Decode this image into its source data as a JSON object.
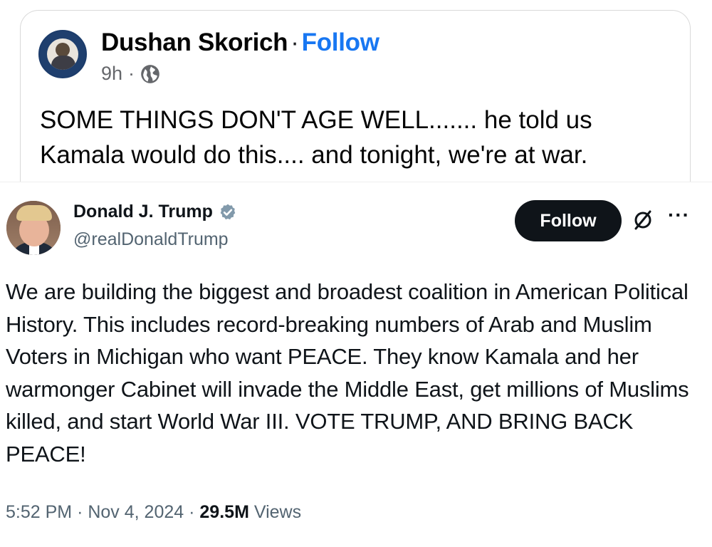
{
  "facebook_post": {
    "author": "Dushan Skorich",
    "separator": "·",
    "follow_label": "Follow",
    "time": "9h",
    "meta_separator": "·",
    "audience_icon": "globe-icon",
    "text": "SOME THINGS DON'T AGE WELL....... he told us Kamala would do this.... and tonight, we're at war."
  },
  "tweet": {
    "author_name": "Donald J. Trump",
    "verified_icon": "verified-badge-icon",
    "handle": "@realDonaldTrump",
    "follow_label": "Follow",
    "grok_icon": "grok-icon",
    "more_icon": "more-icon",
    "more_label": "···",
    "text": "We are building the biggest and broadest coalition in American Political History. This includes record-breaking numbers of Arab and Muslim Voters in Michigan who want PEACE. They know Kamala and her warmonger Cabinet will invade the Middle East, get millions of Muslims killed, and start World War III. VOTE TRUMP, AND BRING BACK PEACE!",
    "time": "5:52 PM",
    "date": "Nov 4, 2024",
    "views_count": "29.5M",
    "views_label": "Views",
    "sep": "·"
  },
  "colors": {
    "facebook_blue": "#1877f2",
    "x_black": "#0f1419",
    "x_gray": "#536471",
    "verified_blue": "#1d9bf0"
  }
}
